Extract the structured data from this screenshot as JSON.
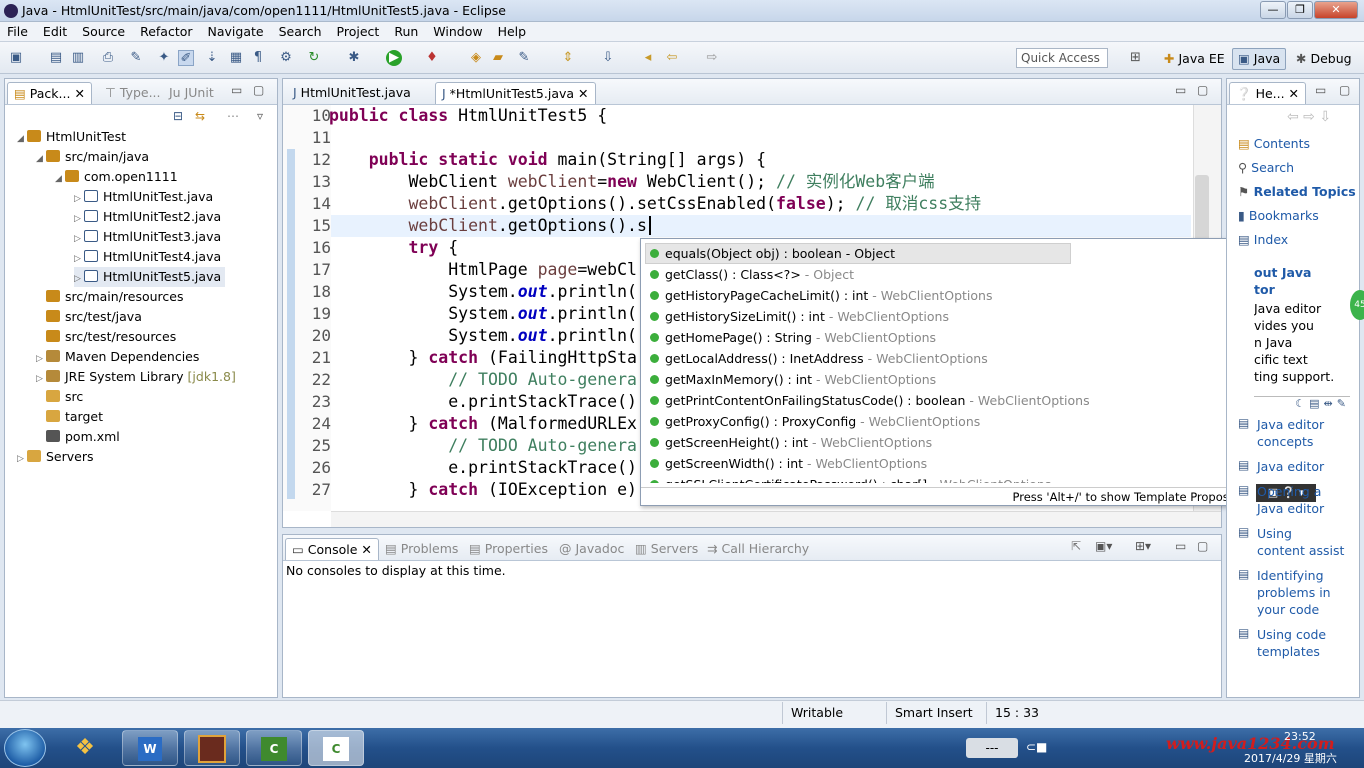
{
  "window": {
    "title": "Java - HtmlUnitTest/src/main/java/com/open1111/HtmlUnitTest5.java - Eclipse"
  },
  "menu": [
    "File",
    "Edit",
    "Source",
    "Refactor",
    "Navigate",
    "Search",
    "Project",
    "Run",
    "Window",
    "Help"
  ],
  "quick_access": "Quick Access",
  "perspectives": [
    "Java EE",
    "Java",
    "Debug"
  ],
  "left_tabs": [
    "Pack...",
    "Type...",
    "JUnit"
  ],
  "tree": [
    {
      "label": "HtmlUnitTest",
      "depth": 0,
      "icon": "project-icon"
    },
    {
      "label": "src/main/java",
      "depth": 1,
      "icon": "source-folder-icon"
    },
    {
      "label": "com.open1111",
      "depth": 2,
      "icon": "package-icon"
    },
    {
      "label": "HtmlUnitTest.java",
      "depth": 3,
      "icon": "java-file-icon"
    },
    {
      "label": "HtmlUnitTest2.java",
      "depth": 3,
      "icon": "java-file-icon"
    },
    {
      "label": "HtmlUnitTest3.java",
      "depth": 3,
      "icon": "java-file-icon"
    },
    {
      "label": "HtmlUnitTest4.java",
      "depth": 3,
      "icon": "java-file-icon"
    },
    {
      "label": "HtmlUnitTest5.java",
      "depth": 3,
      "icon": "java-file-icon"
    },
    {
      "label": "src/main/resources",
      "depth": 1,
      "icon": "source-folder-icon"
    },
    {
      "label": "src/test/java",
      "depth": 1,
      "icon": "source-folder-icon"
    },
    {
      "label": "src/test/resources",
      "depth": 1,
      "icon": "source-folder-icon"
    },
    {
      "label": "Maven Dependencies",
      "depth": 1,
      "icon": "library-icon"
    },
    {
      "label": "JRE System Library",
      "suffix": "[jdk1.8]",
      "depth": 1,
      "icon": "library-icon"
    },
    {
      "label": "src",
      "depth": 1,
      "icon": "folder-icon"
    },
    {
      "label": "target",
      "depth": 1,
      "icon": "folder-icon"
    },
    {
      "label": "pom.xml",
      "depth": 1,
      "icon": "xml-file-icon"
    },
    {
      "label": "Servers",
      "depth": 0,
      "icon": "folder-icon"
    }
  ],
  "editor_tabs": [
    "HtmlUnitTest.java",
    "*HtmlUnitTest5.java"
  ],
  "code_lines": [
    {
      "n": "10",
      "html": "<span class=\"kw\">public class</span> HtmlUnitTest5 {"
    },
    {
      "n": "11",
      "html": ""
    },
    {
      "n": "12",
      "html": "    <span class=\"kw\">public static void</span> main(String[] args) {"
    },
    {
      "n": "13",
      "html": "        WebClient <span class=\"var\">webClient</span>=<span class=\"kw\">new</span> WebClient(); <span class=\"cm\">// 实例化Web客户端</span>"
    },
    {
      "n": "14",
      "html": "        <span class=\"var\">webClient</span>.getOptions().setCssEnabled(<span class=\"kw\">false</span>); <span class=\"cm\">// 取消css支持</span>"
    },
    {
      "n": "15",
      "html": "        <span class=\"var\">webClient</span>.getOptions().s"
    },
    {
      "n": "16",
      "html": "        <span class=\"kw\">try</span> {"
    },
    {
      "n": "17",
      "html": "            HtmlPage <span class=\"var\">page</span>=webCl"
    },
    {
      "n": "18",
      "html": "            System.<span class=\"fld\">out</span>.println("
    },
    {
      "n": "19",
      "html": "            System.<span class=\"fld\">out</span>.println("
    },
    {
      "n": "20",
      "html": "            System.<span class=\"fld\">out</span>.println("
    },
    {
      "n": "21",
      "html": "        } <span class=\"kw\">catch</span> (FailingHttpSta"
    },
    {
      "n": "22",
      "html": "            <span class=\"cm\">// TODO Auto-genera</span>"
    },
    {
      "n": "23",
      "html": "            e.printStackTrace()"
    },
    {
      "n": "24",
      "html": "        } <span class=\"kw\">catch</span> (MalformedURLEx"
    },
    {
      "n": "25",
      "html": "            <span class=\"cm\">// TODO Auto-genera</span>"
    },
    {
      "n": "26",
      "html": "            e.printStackTrace()"
    },
    {
      "n": "27",
      "html": "        } <span class=\"kw\">catch</span> (IOException e)"
    }
  ],
  "completions": [
    {
      "sig": "equals(Object obj) : boolean - Object",
      "src": ""
    },
    {
      "sig": "getClass() : Class<?>",
      "src": " - Object"
    },
    {
      "sig": "getHistoryPageCacheLimit() : int",
      "src": " - WebClientOptions"
    },
    {
      "sig": "getHistorySizeLimit() : int",
      "src": " - WebClientOptions"
    },
    {
      "sig": "getHomePage() : String",
      "src": " - WebClientOptions"
    },
    {
      "sig": "getLocalAddress() : InetAddress",
      "src": " - WebClientOptions"
    },
    {
      "sig": "getMaxInMemory() : int",
      "src": " - WebClientOptions"
    },
    {
      "sig": "getPrintContentOnFailingStatusCode() : boolean",
      "src": " - WebClientOptions"
    },
    {
      "sig": "getProxyConfig() : ProxyConfig",
      "src": " - WebClientOptions"
    },
    {
      "sig": "getScreenHeight() : int",
      "src": " - WebClientOptions"
    },
    {
      "sig": "getScreenWidth() : int",
      "src": " - WebClientOptions"
    },
    {
      "sig": "getSSLClientCertificatePassword() : char[]",
      "src": " - WebClientOptions"
    }
  ],
  "popup_hint": "Press 'Alt+/' to show Template Proposals",
  "console_tabs": [
    "Console",
    "Problems",
    "Properties",
    "Javadoc",
    "Servers",
    "Call Hierarchy"
  ],
  "console_text": "No consoles to display at this time.",
  "help": {
    "tab": "He...",
    "links": [
      "Contents",
      "Search",
      "Related Topics",
      "Bookmarks",
      "Index"
    ],
    "heading": "out Java\ntor",
    "body": "Java editor\nvides you\nn Java\ncific text\nting support.",
    "topics": [
      "Java editor\nconcepts",
      "Java editor",
      "Opening a\nJava editor",
      "Using\ncontent assist",
      "Identifying\nproblems in\nyour code",
      "Using code\ntemplates"
    ]
  },
  "status": {
    "mode": "Writable",
    "insert": "Smart Insert",
    "position": "15 : 33"
  },
  "taskbar": {
    "clock": "23:52",
    "date": "2017/4/29 星期六",
    "watermark": "www.java1234.com"
  }
}
